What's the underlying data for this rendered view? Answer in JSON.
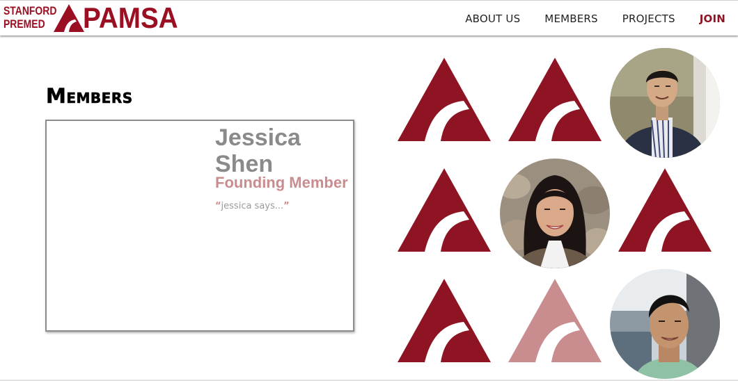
{
  "brand": {
    "line1": "STANFORD",
    "line2": "PREMED",
    "name": "PAMSA",
    "color": "#9a0f21"
  },
  "nav": {
    "items": [
      {
        "label": "ABOUT US"
      },
      {
        "label": "MEMBERS"
      },
      {
        "label": "PROJECTS"
      },
      {
        "label": "JOIN",
        "highlight": true
      }
    ]
  },
  "page": {
    "title": "Members"
  },
  "profile": {
    "name": "Jessica Shen",
    "role": "Founding Member",
    "quote_open": "“",
    "quote": "jessica says...",
    "quote_close": "”"
  },
  "grid": {
    "tiles": [
      {
        "kind": "logo",
        "state": "default"
      },
      {
        "kind": "logo",
        "state": "default"
      },
      {
        "kind": "photo",
        "person": "member-photo-1"
      },
      {
        "kind": "logo",
        "state": "default"
      },
      {
        "kind": "photo",
        "person": "jessica-shen-photo"
      },
      {
        "kind": "logo",
        "state": "default"
      },
      {
        "kind": "logo",
        "state": "default"
      },
      {
        "kind": "logo",
        "state": "selected"
      },
      {
        "kind": "photo",
        "person": "member-photo-2"
      }
    ]
  },
  "colors": {
    "accent": "#8e1423",
    "accent_light": "#c98c8f",
    "name_gray": "#8a8a8a"
  }
}
